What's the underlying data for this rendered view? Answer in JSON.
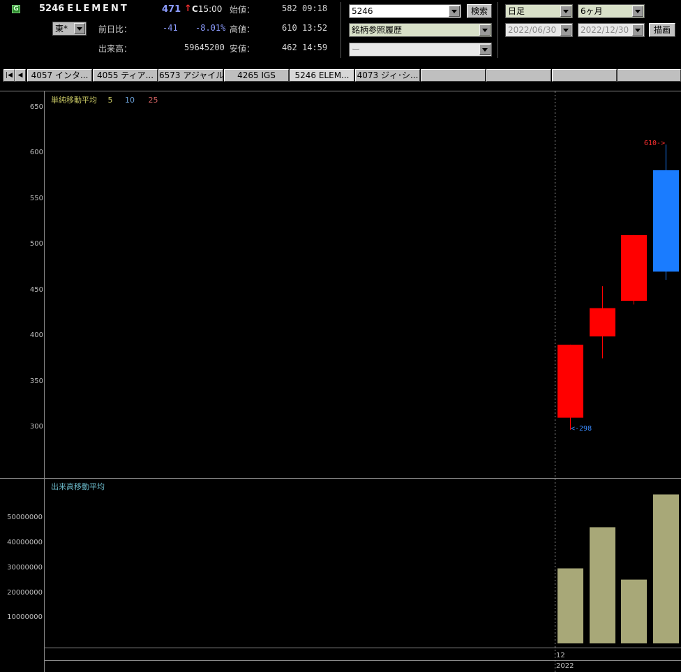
{
  "header": {
    "market_icon": "G",
    "code": "5246",
    "name": "ELEMENT",
    "price": "471",
    "price_direction_icon": "up-arrow-icon",
    "price_time_prefix": "C",
    "price_time": "15:00",
    "exchange": "東*",
    "change_label": "前日比：",
    "change_value": "-41",
    "change_percent": "-8.01%",
    "volume_label": "出来高：",
    "volume_value": "59645200",
    "open_label": "始値：",
    "open_value": "582",
    "open_time": "09:18",
    "high_label": "高値：",
    "high_value": "610",
    "high_time": "13:52",
    "low_label": "安値：",
    "low_value": "462",
    "low_time": "14:59"
  },
  "search": {
    "code_value": "5246",
    "search_button": "検索",
    "history_value": "銘柄参照履歴",
    "third_value": "ー"
  },
  "period": {
    "interval": "日足",
    "span": "6ヶ月",
    "from_date": "2022/06/30",
    "to_date": "2022/12/30",
    "draw_button": "描画"
  },
  "tabs": [
    {
      "label": "4057 インタ..."
    },
    {
      "label": "4055 ティア..."
    },
    {
      "label": "6573 アジャイル"
    },
    {
      "label": "4265 IGS"
    },
    {
      "label": "5246 ELEM..."
    },
    {
      "label": "4073 ジィ･シ..."
    },
    {
      "label": ""
    },
    {
      "label": ""
    },
    {
      "label": ""
    }
  ],
  "price_panel": {
    "title": "単純移動平均",
    "ma_periods": [
      "5",
      "10",
      "25"
    ],
    "ma_colors": [
      "#c8c864",
      "#6aa0d8",
      "#d06060"
    ],
    "y_ticks": [
      "650",
      "600",
      "550",
      "500",
      "450",
      "400",
      "350",
      "300"
    ],
    "high_marker": "610->",
    "low_marker": "<-298"
  },
  "volume_panel": {
    "title": "出来高移動平均",
    "y_ticks": [
      "50000000",
      "40000000",
      "30000000",
      "20000000",
      "10000000"
    ]
  },
  "x_axis": {
    "month": "12",
    "year": "2022"
  },
  "chart_data": {
    "type": "candlestick",
    "ylim_price": [
      255,
      662
    ],
    "ylim_volume": [
      0,
      60000000
    ],
    "candles": [
      {
        "open": 311,
        "high": 298,
        "low": 298,
        "close": 391,
        "color": "red",
        "low_wick": 298
      },
      {
        "open": 400,
        "high": 455,
        "low": 376,
        "close": 431,
        "color": "red"
      },
      {
        "open": 439,
        "high": 511,
        "low": 435,
        "close": 511,
        "color": "red"
      },
      {
        "open": 582,
        "high": 610,
        "low": 462,
        "close": 471,
        "color": "blue"
      }
    ],
    "volumes": [
      30000000,
      46500000,
      25500000,
      59645200
    ],
    "colors": {
      "up": "#ff0000",
      "down": "#1a7cff",
      "volume": "#a8a878"
    }
  }
}
